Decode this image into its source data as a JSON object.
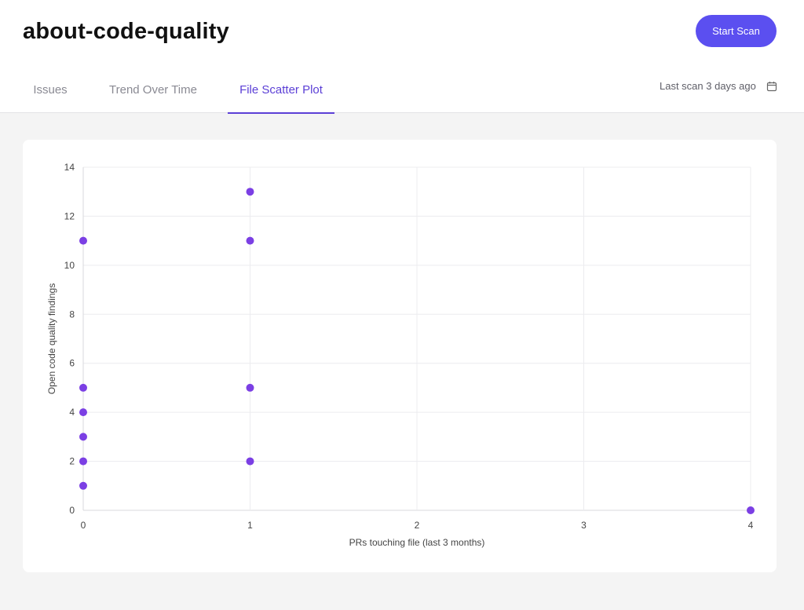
{
  "header": {
    "title": "about-code-quality",
    "start_scan_label": "Start Scan",
    "last_scan": "Last scan 3 days ago"
  },
  "tabs": [
    {
      "label": "Issues"
    },
    {
      "label": "Trend Over Time"
    },
    {
      "label": "File Scatter Plot"
    }
  ],
  "active_tab": "File Scatter Plot",
  "accent_color": "#5b3fd6",
  "icons": {
    "last_scan": "calendar-icon"
  },
  "chart_data": {
    "type": "scatter",
    "xlabel": "PRs touching file (last 3 months)",
    "ylabel": "Open code quality findings",
    "xlim": [
      0,
      4
    ],
    "ylim": [
      0,
      14
    ],
    "x_ticks": [
      0,
      1,
      2,
      3,
      4
    ],
    "y_ticks": [
      0,
      2,
      4,
      6,
      8,
      10,
      12,
      14
    ],
    "grid": true,
    "point_color": "#7b3fe4",
    "points": [
      {
        "x": 0,
        "y": 11
      },
      {
        "x": 0,
        "y": 5
      },
      {
        "x": 0,
        "y": 4
      },
      {
        "x": 0,
        "y": 3
      },
      {
        "x": 0,
        "y": 2
      },
      {
        "x": 0,
        "y": 1
      },
      {
        "x": 1,
        "y": 13
      },
      {
        "x": 1,
        "y": 11
      },
      {
        "x": 1,
        "y": 5
      },
      {
        "x": 1,
        "y": 2
      },
      {
        "x": 4,
        "y": 0
      }
    ]
  }
}
